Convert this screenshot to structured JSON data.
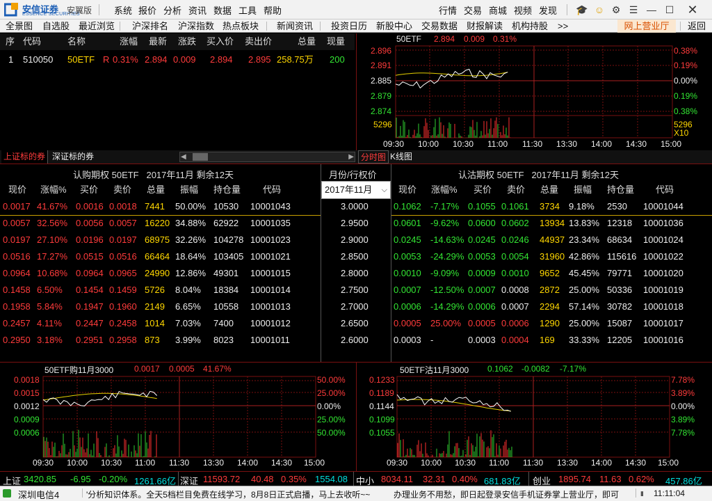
{
  "app": {
    "name": "安信证券",
    "sub": "ESSENCE SECURITIES",
    "edition": "安翼版"
  },
  "menu": [
    "系统",
    "报价",
    "分析",
    "资讯",
    "数据",
    "工具",
    "帮助"
  ],
  "rmenu": [
    "行情",
    "交易",
    "商城",
    "视频",
    "发现"
  ],
  "toolbar": [
    "全景图",
    "自选股",
    "最近浏览",
    "沪深排名",
    "沪深指数",
    "热点板块",
    "新闻资讯",
    "投资日历",
    "新股中心",
    "交易数据",
    "财报解读",
    "机构持股",
    ">>"
  ],
  "netbtn": "网上营业厅",
  "back": "返回",
  "quote": {
    "headers": [
      "序",
      "代码",
      "名称",
      "涨幅",
      "最新",
      "涨跌",
      "买入价",
      "卖出价",
      "总量",
      "现量"
    ],
    "row": {
      "idx": "1",
      "code": "510050",
      "name": "50ETF",
      "flag": "R",
      "chg": "0.31%",
      "last": "2.894",
      "diff": "0.009",
      "bid": "2.894",
      "ask": "2.895",
      "vol": "258.75万",
      "cur": "200"
    }
  },
  "mini": {
    "title": "50ETF",
    "price": "2.894",
    "diff": "0.009",
    "pct": "0.31%",
    "yl": [
      "2.896",
      "2.891",
      "2.885",
      "2.879",
      "2.874"
    ],
    "yr": [
      "0.38%",
      "0.19%",
      "0.00%",
      "0.19%",
      "0.38%"
    ],
    "vl": "5296",
    "vr": "5296",
    "vx": "X10",
    "xt": [
      "09:30",
      "10:00",
      "10:30",
      "11:00",
      "11:30",
      "13:30",
      "14:00",
      "14:30",
      "15:00"
    ]
  },
  "tabs": {
    "left": [
      "上证标的券",
      "深证标的券"
    ],
    "right": [
      "分时图",
      "K线图"
    ]
  },
  "call": {
    "title": "认购期权 50ETF   2017年11月 剩余12天",
    "headers": [
      "现价",
      "涨幅%",
      "买价",
      "卖价",
      "总量",
      "振幅",
      "持仓量",
      "代码"
    ],
    "rows": [
      [
        "0.0017",
        "41.67%",
        "0.0016",
        "0.0018",
        "7441",
        "50.00%",
        "10530",
        "10001043"
      ],
      [
        "0.0057",
        "32.56%",
        "0.0056",
        "0.0057",
        "16220",
        "34.88%",
        "62922",
        "10001035"
      ],
      [
        "0.0197",
        "27.10%",
        "0.0196",
        "0.0197",
        "68975",
        "32.26%",
        "104278",
        "10001023"
      ],
      [
        "0.0516",
        "17.27%",
        "0.0515",
        "0.0516",
        "66464",
        "18.64%",
        "103405",
        "10001021"
      ],
      [
        "0.0964",
        "10.68%",
        "0.0964",
        "0.0965",
        "24990",
        "12.86%",
        "49301",
        "10001015"
      ],
      [
        "0.1458",
        "6.50%",
        "0.1454",
        "0.1459",
        "5726",
        "8.04%",
        "18384",
        "10001014"
      ],
      [
        "0.1958",
        "5.84%",
        "0.1947",
        "0.1960",
        "2149",
        "6.65%",
        "10558",
        "10001013"
      ],
      [
        "0.2457",
        "4.11%",
        "0.2447",
        "0.2458",
        "1014",
        "7.03%",
        "7400",
        "10001012"
      ],
      [
        "0.2950",
        "3.18%",
        "0.2951",
        "0.2958",
        "873",
        "3.99%",
        "8023",
        "10001011"
      ]
    ]
  },
  "mid": {
    "header": "月份/行权价",
    "select": "2017年11月",
    "strikes": [
      "3.0000",
      "2.9500",
      "2.9000",
      "2.8500",
      "2.8000",
      "2.7500",
      "2.7000",
      "2.6500",
      "2.6000"
    ]
  },
  "put": {
    "title": "认沽期权 50ETF   2017年11月 剩余12天",
    "headers": [
      "现价",
      "涨幅%",
      "买价",
      "卖价",
      "总量",
      "振幅",
      "持仓量",
      "代码"
    ],
    "rows": [
      [
        "0.1062",
        "-7.17%",
        "0.1055",
        "0.1061",
        "3734",
        "9.18%",
        "2530",
        "10001044"
      ],
      [
        "0.0601",
        "-9.62%",
        "0.0600",
        "0.0602",
        "13934",
        "13.83%",
        "12318",
        "10001036"
      ],
      [
        "0.0245",
        "-14.63%",
        "0.0245",
        "0.0246",
        "44937",
        "23.34%",
        "68634",
        "10001024"
      ],
      [
        "0.0053",
        "-24.29%",
        "0.0053",
        "0.0054",
        "31960",
        "42.86%",
        "115616",
        "10001022"
      ],
      [
        "0.0010",
        "-9.09%",
        "0.0009",
        "0.0010",
        "9652",
        "45.45%",
        "79771",
        "10001020"
      ],
      [
        "0.0007",
        "-12.50%",
        "0.0007",
        "0.0008",
        "2872",
        "25.00%",
        "50336",
        "10001019"
      ],
      [
        "0.0006",
        "-14.29%",
        "0.0006",
        "0.0007",
        "2294",
        "57.14%",
        "30782",
        "10001018"
      ],
      [
        "0.0005",
        "25.00%",
        "0.0005",
        "0.0006",
        "1290",
        "25.00%",
        "15087",
        "10001017"
      ],
      [
        "0.0003",
        "-",
        "0.0003",
        "0.0004",
        "169",
        "33.33%",
        "12205",
        "10001016"
      ]
    ]
  },
  "callChart": {
    "title": "50ETF购11月3000",
    "price": "0.0017",
    "diff": "0.0005",
    "pct": "41.67%",
    "yl": [
      "0.0018",
      "0.0015",
      "0.0012",
      "0.0009",
      "0.0006"
    ],
    "yr": [
      "50.00%",
      "25.00%",
      "0.00%",
      "25.00%",
      "50.00%"
    ],
    "xt": [
      "09:30",
      "10:00",
      "10:30",
      "11:00",
      "11:30",
      "13:30",
      "14:00",
      "14:30",
      "15:00"
    ]
  },
  "putChart": {
    "title": "50ETF沽11月3000",
    "price": "0.1062",
    "diff": "-0.0082",
    "pct": "-7.17%",
    "yl": [
      "0.1233",
      "0.1189",
      "0.1144",
      "0.1099",
      "0.1055"
    ],
    "yr": [
      "7.78%",
      "3.89%",
      "0.00%",
      "3.89%",
      "7.78%"
    ],
    "xt": [
      "09:30",
      "10:00",
      "10:30",
      "11:00",
      "11:30",
      "13:30",
      "14:00",
      "14:30",
      "15:00"
    ]
  },
  "index": [
    {
      "name": "上证",
      "val": "3420.85",
      "diff": "-6.95",
      "pct": "-0.20%",
      "amt": "1261.66亿"
    },
    {
      "name": "深证",
      "val": "11593.72",
      "diff": "40.48",
      "pct": "0.35%",
      "amt": "1554.08亿"
    },
    {
      "name": "中小",
      "val": "8034.11",
      "diff": "32.31",
      "pct": "0.40%",
      "amt": "681.83亿"
    },
    {
      "name": "创业",
      "val": "1895.74",
      "diff": "11.63",
      "pct": "0.62%",
      "amt": "457.86亿"
    }
  ],
  "status": {
    "isp": "深圳电信4",
    "ticker": "'分析知识体系。全天5档栏目免费在线学习，8月8日正式启播，马上去收听~~",
    "ticker2": "办理业务不用愁，即日起登录安信手机证券掌上营业厅，即可",
    "time": "11:11:04"
  }
}
